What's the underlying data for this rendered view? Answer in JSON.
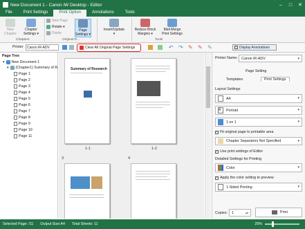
{
  "window": {
    "title": "New Document 1 - Canon iW Desktop - Editor"
  },
  "ribbon_tabs": [
    "File",
    "Print Settings",
    "Print Option",
    "Annotations",
    "Tools"
  ],
  "ribbon": {
    "new_chapter": "New\nChapter",
    "chapter_settings": "Chapter\nSettings ▾",
    "new_page": "New Page",
    "rotate": "Rotate ▾",
    "divide": "Divide",
    "page_settings": "Page\nSettings ▾",
    "insert_update": "Insert/Update\n▾",
    "reduce_block": "Reduce Block\nMargins ▾",
    "mail_merge": "Mail Merge\nPrint Settings",
    "group_chapters": "Chapters",
    "group_original": "Original D...",
    "group_tools": "Tools"
  },
  "toolbar": {
    "printer_label": "Printer",
    "printer_value": "Canon iR-ADV",
    "clear_button": "Clear All Original Page Settings",
    "display_annotations": "Display Annotations"
  },
  "page_tree": {
    "header": "Page Tree",
    "root": "New Document 1",
    "chapter": "(Chapter1) Summary of R...",
    "pages": [
      "Page 1",
      "Page 2",
      "Page 3",
      "Page 4",
      "Page 5",
      "Page 6",
      "Page 7",
      "Page 8",
      "Page 9",
      "Page 10",
      "Page 11"
    ]
  },
  "preview": {
    "page_labels": [
      "1-1",
      "1-2"
    ],
    "page_numbers": [
      "3",
      "4"
    ],
    "page1_heading": "Summary of Research"
  },
  "settings_panel": {
    "printer_label": "Printer Name:",
    "printer_value": "Canon iR-ADV",
    "section": "Page Setting",
    "tab_templates": "Templates",
    "tab_print_settings": "Print Settings",
    "layout_settings": "Layout Settings",
    "paper_size": "A4",
    "orientation": "Portrait",
    "pages_per_sheet": "1 on 1",
    "fit_original": "Fit original page to printable area",
    "chapter_separators": "Chapter Separators Not Specified",
    "use_print_settings": "Use print settings of Editor",
    "detailed_settings": "Detailed Settings for Printing",
    "color": "Color",
    "apply_color": "Apply the color setting to preview",
    "sided": "1-Sided Printing",
    "copies_label": "Copies:",
    "copies_value": "1",
    "print_button": "Print"
  },
  "status": {
    "selected": "Selected Page: /11",
    "output_size": "Output Size:A4",
    "total_sheets": "Total Sheets: 11",
    "zoom": "25%"
  }
}
